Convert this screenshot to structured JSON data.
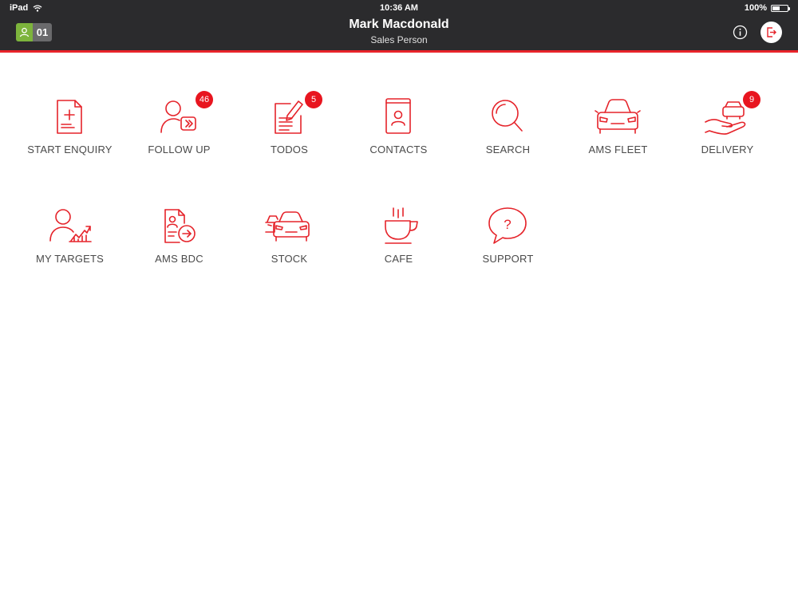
{
  "status_bar": {
    "device": "iPad",
    "time": "10:36 AM",
    "battery_text": "100%",
    "battery_level": 0.5
  },
  "header": {
    "user_name": "Mark Macdonald",
    "user_role": "Sales Person",
    "user_badge_number": "01",
    "colors": {
      "background": "#2b2b2d",
      "accent": "#e8242a",
      "badge_green": "#7db43c"
    }
  },
  "tiles": [
    {
      "label": "START ENQUIRY",
      "icon": "document-plus-icon",
      "badge": null
    },
    {
      "label": "FOLLOW UP",
      "icon": "user-forward-icon",
      "badge": "46"
    },
    {
      "label": "TODOS",
      "icon": "document-pencil-icon",
      "badge": "5"
    },
    {
      "label": "CONTACTS",
      "icon": "contact-book-icon",
      "badge": null
    },
    {
      "label": "SEARCH",
      "icon": "search-icon",
      "badge": null
    },
    {
      "label": "AMS FLEET",
      "icon": "car-front-icon",
      "badge": null
    },
    {
      "label": "DELIVERY",
      "icon": "car-hand-icon",
      "badge": "9"
    },
    {
      "label": "MY TARGETS",
      "icon": "user-chart-icon",
      "badge": null
    },
    {
      "label": "AMS BDC",
      "icon": "document-user-arrow-icon",
      "badge": null
    },
    {
      "label": "STOCK",
      "icon": "cars-icon",
      "badge": null
    },
    {
      "label": "CAFE",
      "icon": "coffee-cup-icon",
      "badge": null
    },
    {
      "label": "SUPPORT",
      "icon": "speech-question-icon",
      "badge": null
    }
  ],
  "support_glyph": "?"
}
